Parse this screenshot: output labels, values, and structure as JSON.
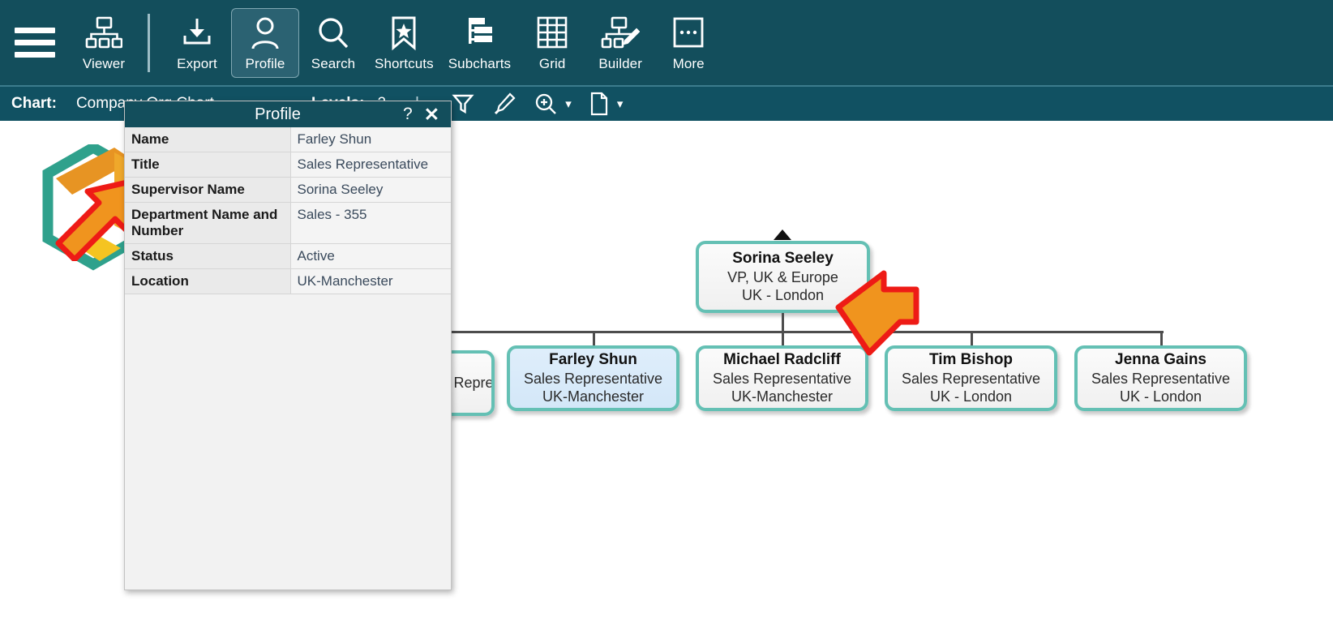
{
  "toolbar": {
    "menu_icon": "hamburger-icon",
    "items": [
      {
        "label": "Viewer",
        "icon": "org-chart-icon",
        "active": false
      },
      {
        "label": "Export",
        "icon": "download-icon",
        "active": false
      },
      {
        "label": "Profile",
        "icon": "person-icon",
        "active": true
      },
      {
        "label": "Search",
        "icon": "magnifier-icon",
        "active": false
      },
      {
        "label": "Shortcuts",
        "icon": "bookmark-star-icon",
        "active": false
      },
      {
        "label": "Subcharts",
        "icon": "subchart-icon",
        "active": false
      },
      {
        "label": "Grid",
        "icon": "grid-table-icon",
        "active": false
      },
      {
        "label": "Builder",
        "icon": "builder-pencil-icon",
        "active": false
      },
      {
        "label": "More",
        "icon": "ellipsis-box-icon",
        "active": false
      }
    ]
  },
  "chartbar": {
    "chart_label": "Chart:",
    "chart_value": "Company Org Chart",
    "levels_label": "Levels:",
    "levels_value": "2",
    "filter_icon": "funnel-icon",
    "highlight_icon": "highlighter-icon",
    "zoom_icon": "zoom-in-icon",
    "page_icon": "page-icon"
  },
  "dialog": {
    "title": "Profile",
    "help_label": "?",
    "close_label": "✕",
    "rows": [
      {
        "key": "Name",
        "value": "Farley Shun"
      },
      {
        "key": "Title",
        "value": "Sales Representative"
      },
      {
        "key": "Supervisor Name",
        "value": "Sorina Seeley"
      },
      {
        "key": "Department Name and Number",
        "value": "Sales - 355"
      },
      {
        "key": "Status",
        "value": "Active"
      },
      {
        "key": "Location",
        "value": "UK-Manchester"
      }
    ]
  },
  "chart": {
    "root": {
      "name": "Sorina Seeley",
      "title": "VP, UK & Europe",
      "location": "UK - London",
      "selected": false
    },
    "children": [
      {
        "name": "",
        "title": "Sales Representative",
        "location": "",
        "selected": false,
        "clipped": true
      },
      {
        "name": "Farley Shun",
        "title": "Sales Representative",
        "location": "UK-Manchester",
        "selected": true
      },
      {
        "name": "Michael Radcliff",
        "title": "Sales Representative",
        "location": "UK-Manchester",
        "selected": false
      },
      {
        "name": "Tim Bishop",
        "title": "Sales Representative",
        "location": "UK - London",
        "selected": false
      },
      {
        "name": "Jenna Gains",
        "title": "Sales Representative",
        "location": "UK - London",
        "selected": false
      }
    ]
  },
  "annotations": [
    {
      "name": "arrow-pointing-logo",
      "direction": "up-right"
    },
    {
      "name": "arrow-pointing-root-node",
      "direction": "up-left"
    }
  ],
  "colors": {
    "toolbar_bg": "#134e5c",
    "chartbar_bg": "#115162",
    "node_border": "#64c0b4",
    "node_selected_bg": "#d8e9f8",
    "arrow_fill": "#f0941e",
    "arrow_stroke": "#ee1b16"
  }
}
